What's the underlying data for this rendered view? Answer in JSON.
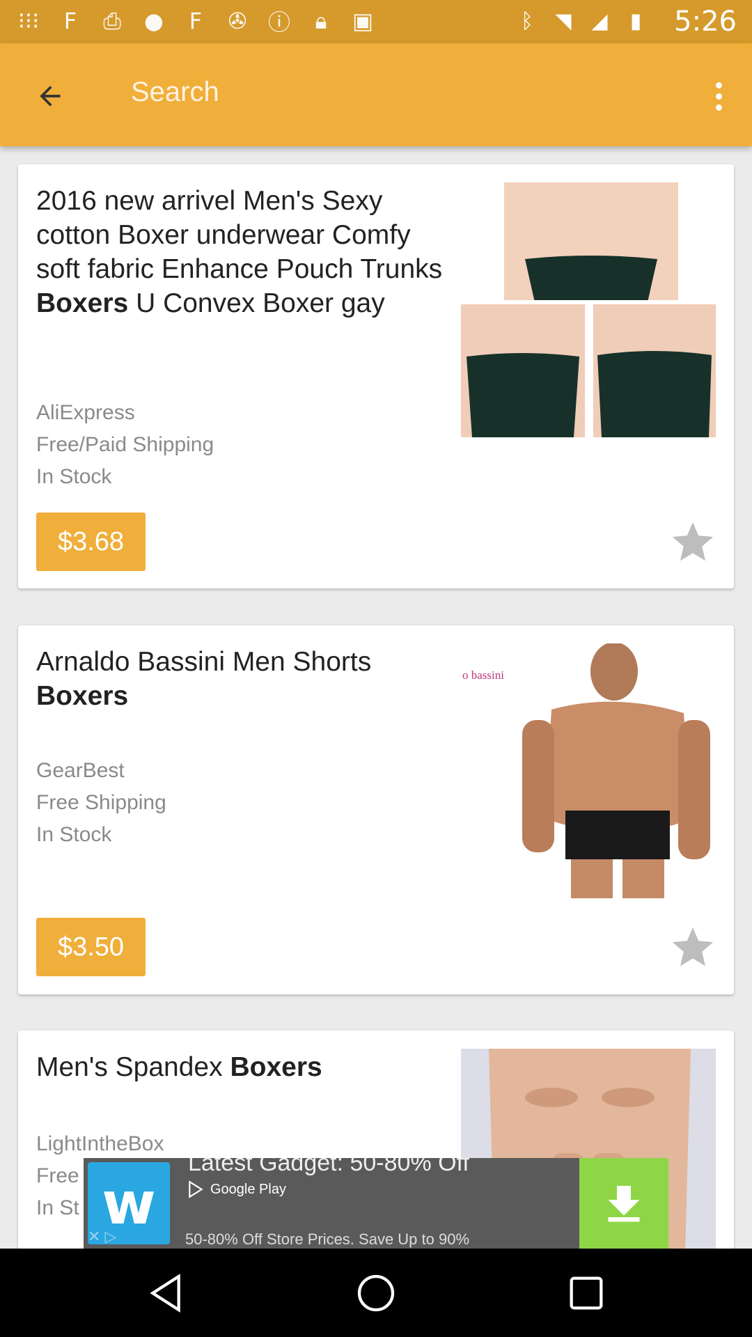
{
  "status_bar": {
    "time": "5:26",
    "left_icons": [
      "notification-icon",
      "fabric-icon",
      "fax-icon",
      "circle-icon",
      "fabric-icon",
      "satellite-icon",
      "alert-icon",
      "lock-icon",
      "android-icon"
    ],
    "right_icons": [
      "bluetooth-icon",
      "wifi-icon",
      "signal-icon",
      "battery-icon"
    ]
  },
  "toolbar": {
    "search_placeholder": "Search",
    "accent": "#f0ae3a"
  },
  "products": [
    {
      "title_pre": "2016 new arrivel Men's Sexy cotton Boxer underwear Comfy soft fabric Enhance Pouch Trunks ",
      "title_bold": "Boxers",
      "title_post": " U Convex Boxer gay",
      "store": "AliExpress",
      "shipping": "Free/Paid Shipping",
      "stock": "In Stock",
      "price": "$3.68"
    },
    {
      "title_pre": "Arnaldo Bassini Men Shorts ",
      "title_bold": "Boxers",
      "title_post": "",
      "store": "GearBest",
      "shipping": "Free Shipping",
      "stock": "In Stock",
      "price": "$3.50",
      "image_brand": "o bassini"
    },
    {
      "title_pre": "Men's Spandex ",
      "title_bold": "Boxers",
      "title_post": "",
      "store": "LightIntheBox",
      "shipping": "Free",
      "stock": "In St"
    }
  ],
  "ad": {
    "headline": "Latest Gadget: 50-80% Off",
    "store_badge": "Google Play",
    "subtext": "50-80% Off Store Prices. Save Up to 90%"
  }
}
